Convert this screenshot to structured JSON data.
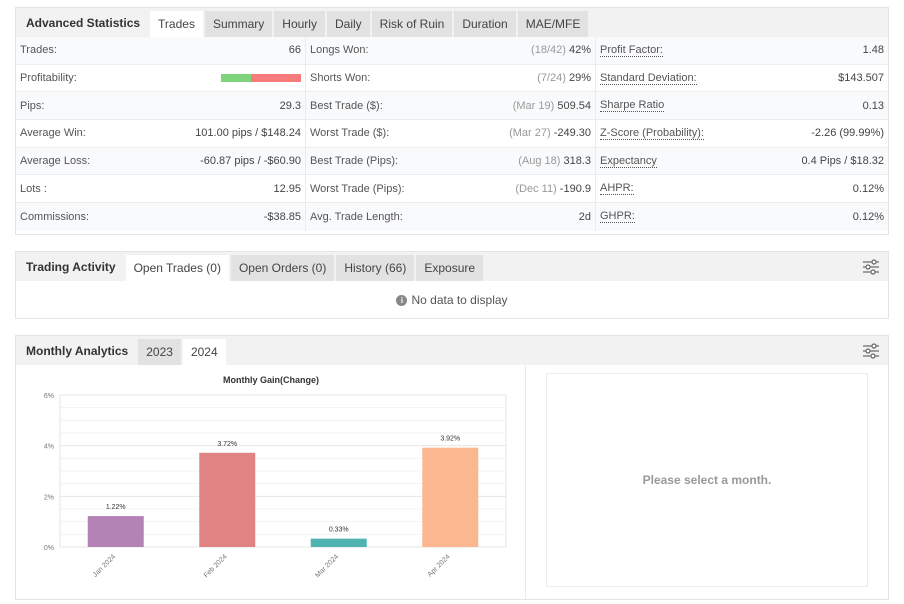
{
  "advanced_statistics": {
    "title": "Advanced Statistics",
    "tabs": [
      {
        "label": "Trades",
        "active": true
      },
      {
        "label": "Summary",
        "active": false
      },
      {
        "label": "Hourly",
        "active": false
      },
      {
        "label": "Daily",
        "active": false
      },
      {
        "label": "Risk of Ruin",
        "active": false
      },
      {
        "label": "Duration",
        "active": false
      },
      {
        "label": "MAE/MFE",
        "active": false
      }
    ],
    "col1": [
      {
        "label": "Trades:",
        "value": "66"
      },
      {
        "label": "Profitability:",
        "profit_win_fraction": 0.38
      },
      {
        "label": "Pips:",
        "value": "29.3"
      },
      {
        "label": "Average Win:",
        "value": "101.00 pips / $148.24"
      },
      {
        "label": "Average Loss:",
        "value": "-60.87 pips / -$60.90"
      },
      {
        "label": "Lots :",
        "value": "12.95"
      },
      {
        "label": "Commissions:",
        "value": "-$38.85"
      }
    ],
    "col2": [
      {
        "label": "Longs Won:",
        "note": "(18/42)",
        "value": "42%"
      },
      {
        "label": "Shorts Won:",
        "note": "(7/24)",
        "value": "29%"
      },
      {
        "label": "Best Trade ($):",
        "note": "(Mar 19)",
        "value": "509.54"
      },
      {
        "label": "Worst Trade ($):",
        "note": "(Mar 27)",
        "value": "-249.30"
      },
      {
        "label": "Best Trade (Pips):",
        "note": "(Aug 18)",
        "value": "318.3"
      },
      {
        "label": "Worst Trade (Pips):",
        "note": "(Dec 11)",
        "value": "-190.9"
      },
      {
        "label": "Avg. Trade Length:",
        "note": "",
        "value": "2d"
      }
    ],
    "col3": [
      {
        "label": "Profit Factor:",
        "value": "1.48"
      },
      {
        "label": "Standard Deviation:",
        "value": "$143.507"
      },
      {
        "label": "Sharpe Ratio",
        "value": "0.13"
      },
      {
        "label": "Z-Score (Probability):",
        "value": "-2.26 (99.99%)"
      },
      {
        "label": "Expectancy",
        "value": "0.4 Pips / $18.32"
      },
      {
        "label": "AHPR:",
        "value": "0.12%"
      },
      {
        "label": "GHPR:",
        "value": "0.12%"
      }
    ]
  },
  "trading_activity": {
    "title": "Trading Activity",
    "tabs": [
      {
        "label": "Open Trades (0)",
        "active": true
      },
      {
        "label": "Open Orders (0)",
        "active": false
      },
      {
        "label": "History (66)",
        "active": false
      },
      {
        "label": "Exposure",
        "active": false
      }
    ],
    "empty_message": "No data to display",
    "settings_icon": "sliders-icon"
  },
  "monthly_analytics": {
    "title": "Monthly Analytics",
    "tabs": [
      {
        "label": "2023",
        "active": false
      },
      {
        "label": "2024",
        "active": true
      }
    ],
    "settings_icon": "sliders-icon",
    "detail_placeholder": "Please select a month."
  },
  "chart_data": {
    "type": "bar",
    "title": "Monthly Gain(Change)",
    "categories": [
      "Jan 2024",
      "Feb 2024",
      "Mar 2024",
      "Apr 2024"
    ],
    "values": [
      1.22,
      3.72,
      0.33,
      3.92
    ],
    "data_labels": [
      "1.22%",
      "3.72%",
      "0.33%",
      "3.92%"
    ],
    "colors": [
      "#b383b5",
      "#e08383",
      "#4fb3b0",
      "#fbb78f"
    ],
    "xlabel": "",
    "ylabel": "",
    "ylim": [
      0,
      6
    ],
    "yticks": [
      0,
      2,
      4,
      6
    ],
    "ytick_labels": [
      "0%",
      "2%",
      "4%",
      "6%"
    ],
    "grid": true
  }
}
